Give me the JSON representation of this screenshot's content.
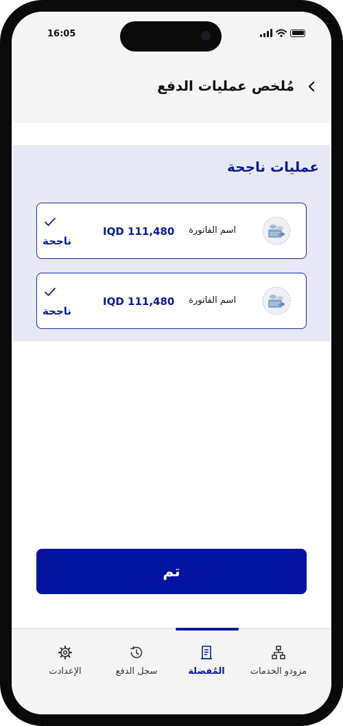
{
  "status_bar": {
    "time": "16:05"
  },
  "header": {
    "title": "مُلخص عمليات الدفع",
    "back_icon": "chevron-left-icon"
  },
  "section": {
    "title": "عمليات ناجحة",
    "transactions": [
      {
        "name": "اسم الفاتورة",
        "amount": "IQD 111,480",
        "status": "ناجحة",
        "logo_icon": "coins-logo-icon",
        "status_icon": "checkmark-icon"
      },
      {
        "name": "اسم الفاتورة",
        "amount": "IQD 111,480",
        "status": "ناجحة",
        "logo_icon": "coins-logo-icon",
        "status_icon": "checkmark-icon"
      }
    ]
  },
  "primary_button": {
    "label": "تم"
  },
  "bottom_nav": {
    "items": [
      {
        "label": "مزودو الخدمات",
        "icon": "sitemap-icon",
        "active": false
      },
      {
        "label": "المُفضلة",
        "icon": "receipt-icon",
        "active": true
      },
      {
        "label": "سجل الدفع",
        "icon": "history-icon",
        "active": false
      },
      {
        "label": "الإعدادت",
        "icon": "gear-icon",
        "active": false
      }
    ]
  },
  "colors": {
    "accent": "#0514A0",
    "panel_bg": "#E6E8F5",
    "text": "#111111"
  }
}
